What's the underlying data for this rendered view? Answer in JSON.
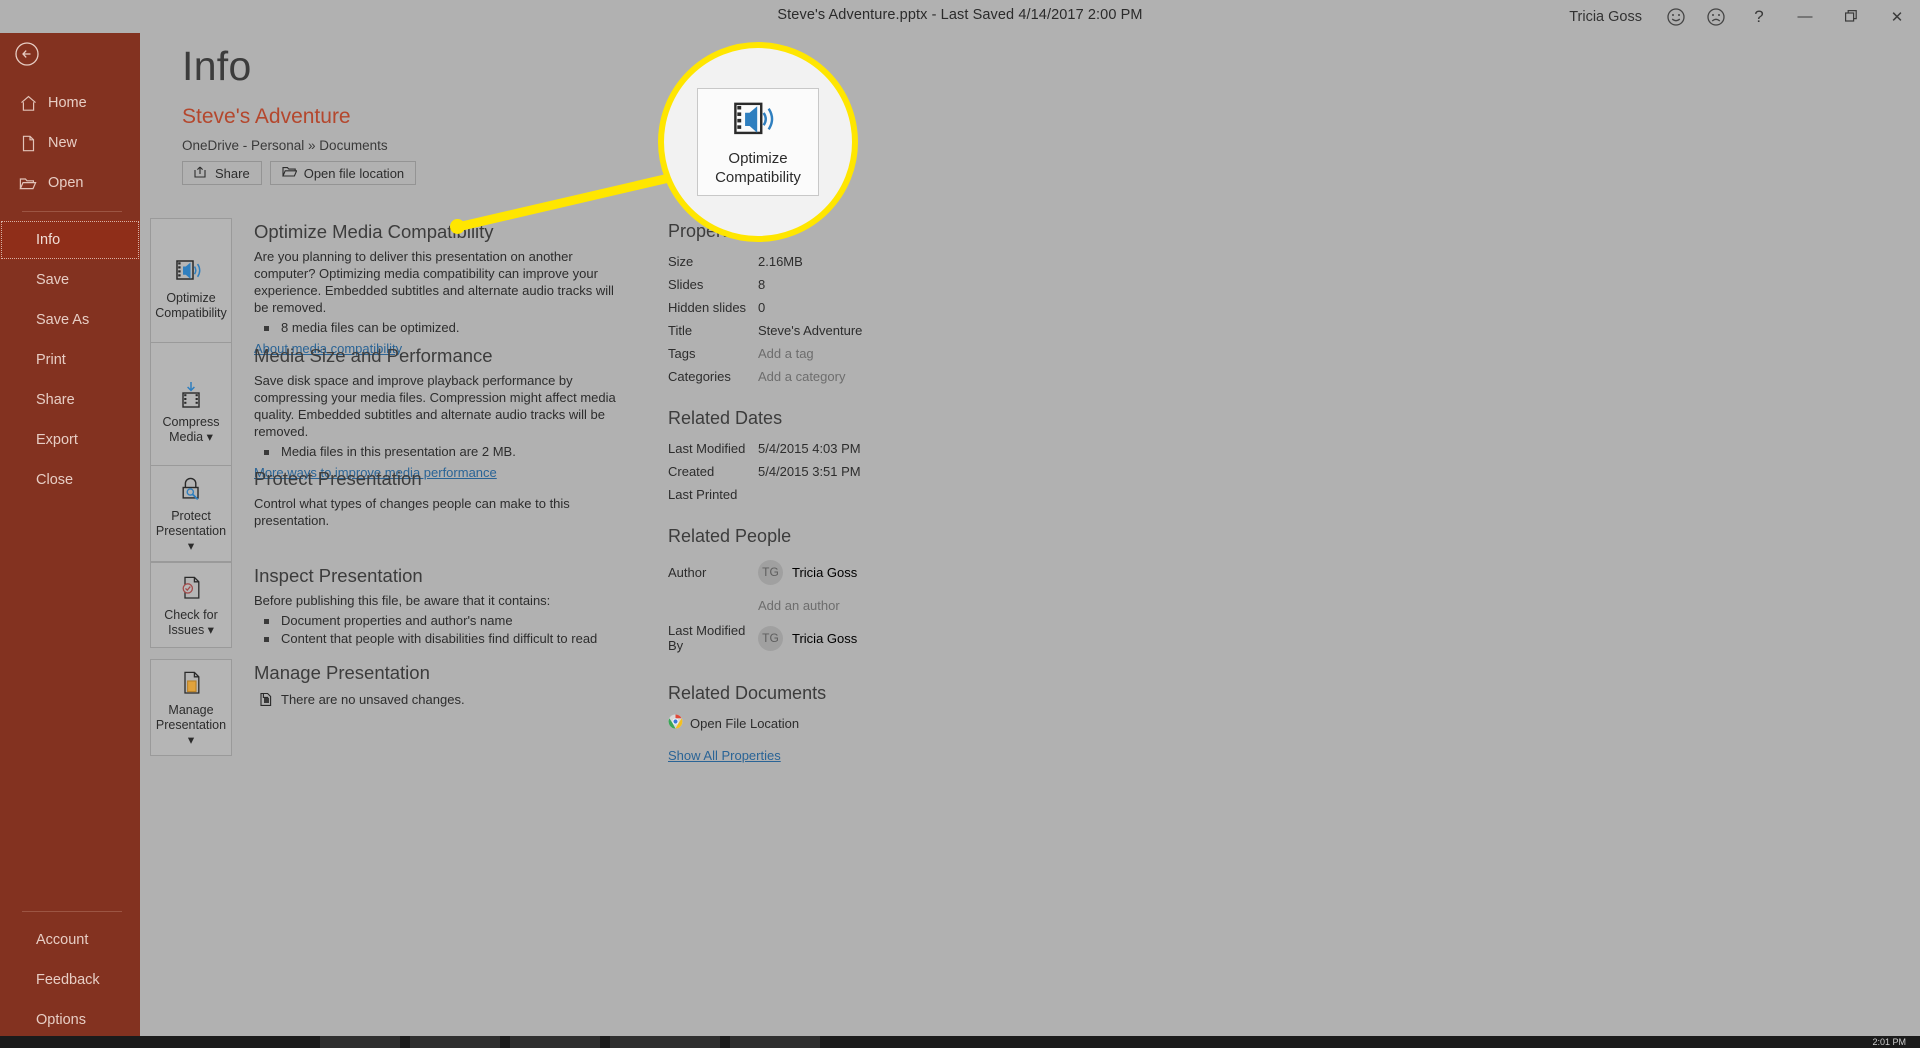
{
  "titlebar": {
    "document_title": "Steve's Adventure.pptx  -  Last Saved 4/14/2017 2:00 PM",
    "user_name": "Tricia Goss",
    "smiley_icon": "smiley-face-icon",
    "frowny_icon": "frowny-face-icon",
    "help_label": "?",
    "minimize_label": "—",
    "restore_label": "❐",
    "close_label": "✕"
  },
  "nav": {
    "back_icon": "back-arrow-icon",
    "top_items": [
      {
        "label": "Home",
        "icon": "home-icon"
      },
      {
        "label": "New",
        "icon": "new-document-icon"
      },
      {
        "label": "Open",
        "icon": "open-folder-icon"
      }
    ],
    "main_items": [
      {
        "label": "Info",
        "active": true
      },
      {
        "label": "Save",
        "active": false
      },
      {
        "label": "Save As",
        "active": false
      },
      {
        "label": "Print",
        "active": false
      },
      {
        "label": "Share",
        "active": false
      },
      {
        "label": "Export",
        "active": false
      },
      {
        "label": "Close",
        "active": false
      }
    ],
    "bottom_items": [
      {
        "label": "Account"
      },
      {
        "label": "Feedback"
      },
      {
        "label": "Options"
      }
    ]
  },
  "header": {
    "page_title": "Info",
    "document_name": "Steve's Adventure",
    "document_path": "OneDrive - Personal » Documents",
    "buttons": [
      {
        "label": "Share",
        "icon": "share-icon"
      },
      {
        "label": "Open file location",
        "icon": "folder-open-icon"
      }
    ]
  },
  "sections": [
    {
      "id": "optimize-media-compatibility",
      "button_label": "Optimize\nCompatibility",
      "button_icon": "media-speaker-icon",
      "heading": "Optimize Media Compatibility",
      "description": "Are you planning to deliver this presentation on another computer? Optimizing media compatibility can improve your experience. Embedded subtitles and alternate audio tracks will be removed.",
      "bullets": [
        "8 media files can be optimized."
      ],
      "link": "About media compatibility"
    },
    {
      "id": "media-size-and-performance",
      "button_label": "Compress\nMedia ▾",
      "button_icon": "compress-media-icon",
      "heading": "Media Size and Performance",
      "description": "Save disk space and improve playback performance by compressing your media files. Compression might affect media quality. Embedded subtitles and alternate audio tracks will be removed.",
      "bullets": [
        "Media files in this presentation are 2 MB."
      ],
      "link": "More ways to improve media performance"
    },
    {
      "id": "protect-presentation",
      "button_label": "Protect\nPresentation ▾",
      "button_icon": "lock-icon",
      "heading": "Protect Presentation",
      "description": "Control what types of changes people can make to this presentation.",
      "bullets": [],
      "link": ""
    },
    {
      "id": "inspect-presentation",
      "button_label": "Check for\nIssues ▾",
      "button_icon": "check-document-icon",
      "heading": "Inspect Presentation",
      "description": "Before publishing this file, be aware that it contains:",
      "bullets": [
        "Document properties and author's name",
        "Content that people with disabilities find difficult to read"
      ],
      "link": ""
    },
    {
      "id": "manage-presentation",
      "button_label": "Manage\nPresentation ▾",
      "button_icon": "manage-document-icon",
      "heading": "Manage Presentation",
      "description": "",
      "bullets": [
        "There are no unsaved changes."
      ],
      "link": ""
    }
  ],
  "properties": {
    "heading": "Properties",
    "rows": [
      {
        "key": "Size",
        "value": "2.16MB",
        "muted": false
      },
      {
        "key": "Slides",
        "value": "8",
        "muted": false
      },
      {
        "key": "Hidden slides",
        "value": "0",
        "muted": false
      },
      {
        "key": "Title",
        "value": "Steve's Adventure",
        "muted": false
      },
      {
        "key": "Tags",
        "value": "Add a tag",
        "muted": true
      },
      {
        "key": "Categories",
        "value": "Add a category",
        "muted": true
      }
    ]
  },
  "related_dates": {
    "heading": "Related Dates",
    "rows": [
      {
        "key": "Last Modified",
        "value": "5/4/2015 4:03 PM",
        "muted": false
      },
      {
        "key": "Created",
        "value": "5/4/2015 3:51 PM",
        "muted": false
      },
      {
        "key": "Last Printed",
        "value": "",
        "muted": false
      }
    ]
  },
  "related_people": {
    "heading": "Related People",
    "author_key": "Author",
    "author_initials": "TG",
    "author_name": "Tricia Goss",
    "add_author_label": "Add an author",
    "modified_by_key": "Last Modified By",
    "modified_by_initials": "TG",
    "modified_by_name": "Tricia Goss"
  },
  "related_documents": {
    "heading": "Related Documents",
    "open_file_location_label": "Open File Location",
    "open_file_location_icon": "chrome-icon",
    "show_all_properties_label": "Show All Properties"
  },
  "callout": {
    "zoom_label": "Optimize\nCompatibility",
    "zoom_icon": "media-speaker-icon",
    "ring_color": "#ffe600",
    "dot_color": "#ffe600"
  },
  "taskbar": {
    "clock": "2:01 PM"
  }
}
